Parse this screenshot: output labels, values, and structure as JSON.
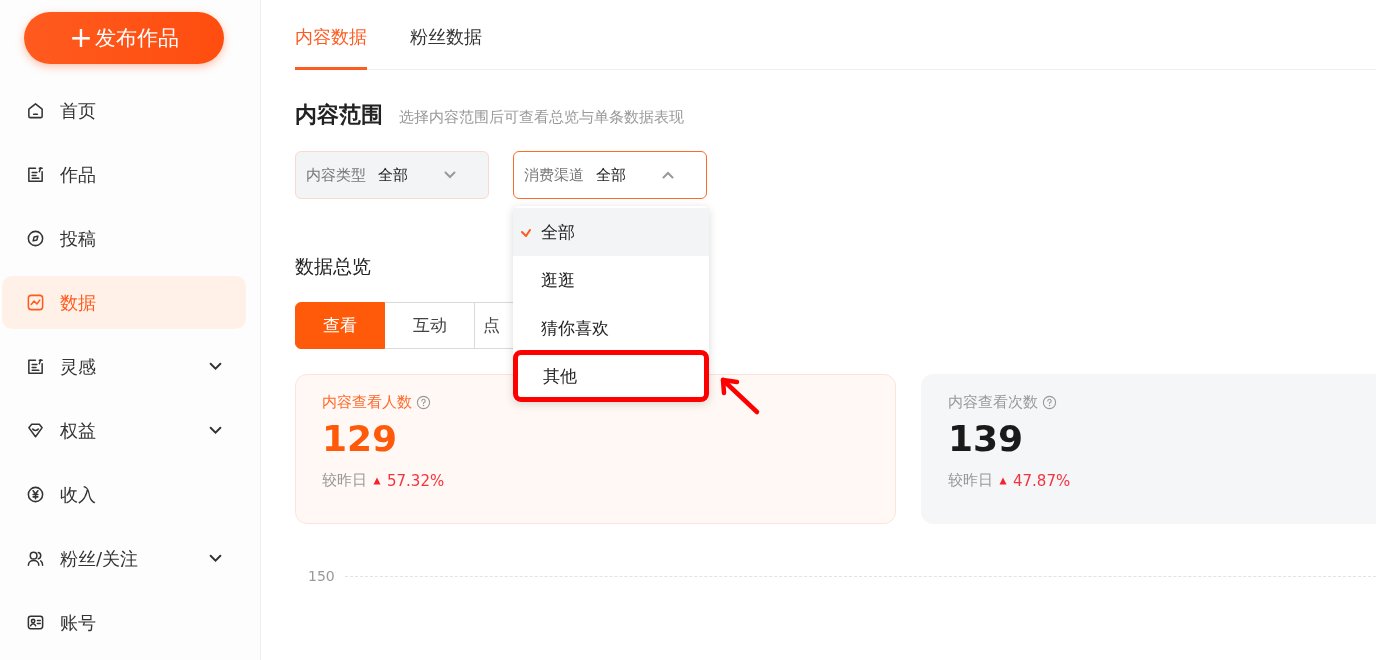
{
  "publish_button": {
    "label": "发布作品",
    "icon": "+"
  },
  "sidebar": {
    "items": [
      {
        "label": "首页",
        "selected": false,
        "expandable": false
      },
      {
        "label": "作品",
        "selected": false,
        "expandable": false
      },
      {
        "label": "投稿",
        "selected": false,
        "expandable": false
      },
      {
        "label": "数据",
        "selected": true,
        "expandable": false
      },
      {
        "label": "灵感",
        "selected": false,
        "expandable": true
      },
      {
        "label": "权益",
        "selected": false,
        "expandable": true
      },
      {
        "label": "收入",
        "selected": false,
        "expandable": false
      },
      {
        "label": "粉丝/关注",
        "selected": false,
        "expandable": true
      },
      {
        "label": "账号",
        "selected": false,
        "expandable": false
      }
    ]
  },
  "tabs": [
    {
      "label": "内容数据",
      "selected": true
    },
    {
      "label": "粉丝数据",
      "selected": false
    }
  ],
  "content_range": {
    "title": "内容范围",
    "hint": "选择内容范围后可查看总览与单条数据表现",
    "filters": [
      {
        "label": "内容类型",
        "value": "全部",
        "expanded": false
      },
      {
        "label": "消费渠道",
        "value": "全部",
        "expanded": true
      }
    ],
    "dropdown_options": [
      {
        "label": "全部",
        "selected": true,
        "highlighted": false
      },
      {
        "label": "逛逛",
        "selected": false,
        "highlighted": false
      },
      {
        "label": "猜你喜欢",
        "selected": false,
        "highlighted": false
      },
      {
        "label": "其他",
        "selected": false,
        "highlighted": true
      }
    ]
  },
  "overview": {
    "title": "数据总览",
    "segments": [
      {
        "label": "查看",
        "selected": true
      },
      {
        "label": "互动",
        "selected": false
      },
      {
        "label": "点",
        "selected": false
      }
    ],
    "cards": [
      {
        "label": "内容查看人数",
        "value": "129",
        "compare_label": "较昨日",
        "change": "57.32%",
        "selected": true
      },
      {
        "label": "内容查看次数",
        "value": "139",
        "compare_label": "较昨日",
        "change": "47.87%",
        "selected": false
      }
    ],
    "chart_axis_label": "150"
  }
}
